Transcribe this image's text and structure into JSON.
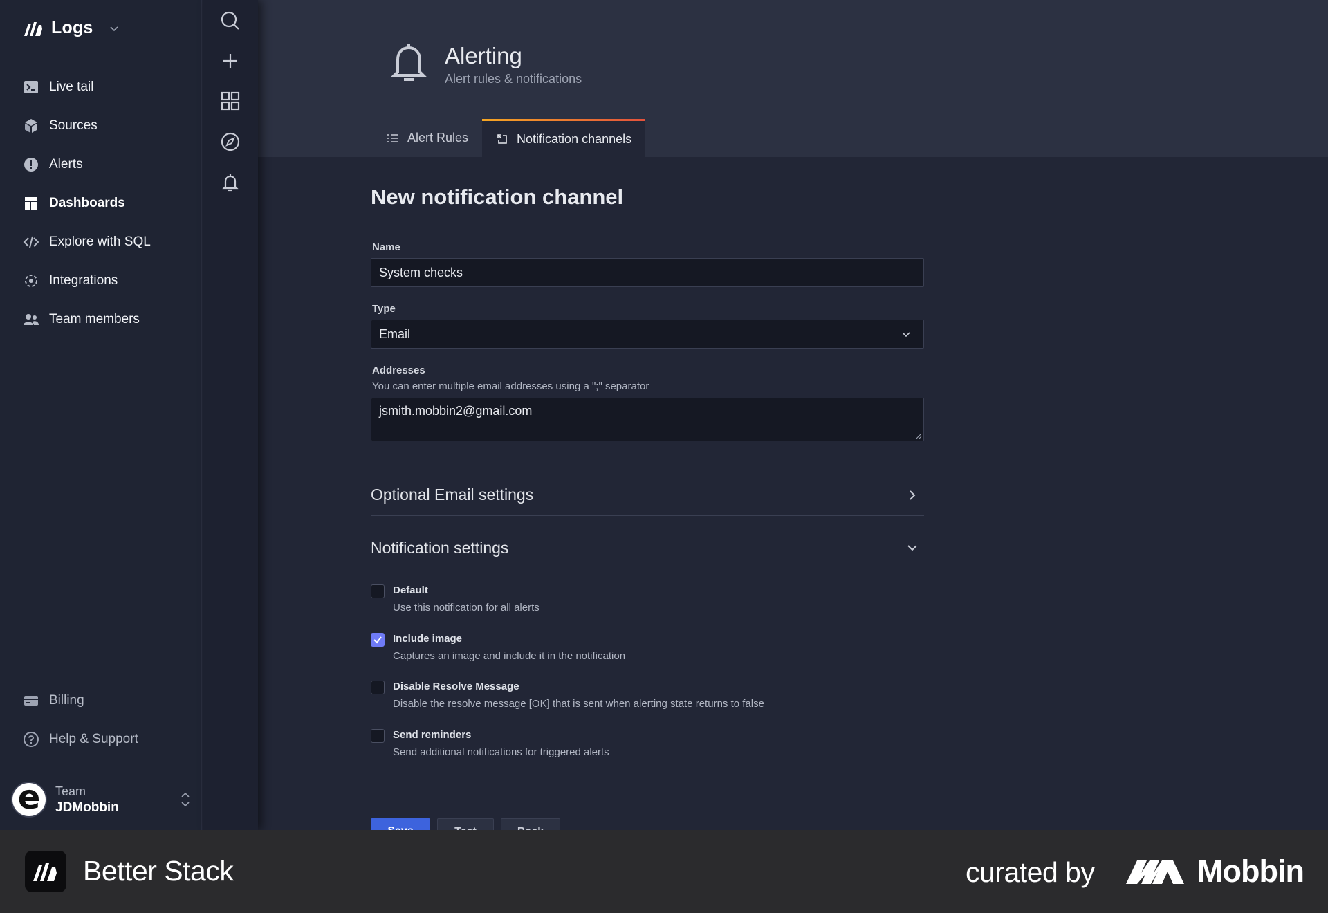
{
  "app": {
    "name": "Logs"
  },
  "sidebar": {
    "items": [
      {
        "label": "Live tail",
        "icon": "terminal-icon"
      },
      {
        "label": "Sources",
        "icon": "cube-icon"
      },
      {
        "label": "Alerts",
        "icon": "alert-circle-icon"
      },
      {
        "label": "Dashboards",
        "icon": "dashboard-icon"
      },
      {
        "label": "Explore with SQL",
        "icon": "code-icon"
      },
      {
        "label": "Integrations",
        "icon": "integrations-icon"
      },
      {
        "label": "Team members",
        "icon": "team-icon"
      }
    ],
    "bottom_items": [
      {
        "label": "Billing",
        "icon": "credit-card-icon"
      },
      {
        "label": "Help & Support",
        "icon": "help-circle-icon"
      }
    ],
    "team": {
      "label": "Team",
      "name": "JDMobbin",
      "avatar_letter": "e"
    }
  },
  "rail": {
    "icons": [
      "search-icon",
      "plus-icon",
      "grid-icon",
      "compass-icon",
      "bell-icon"
    ]
  },
  "header": {
    "title": "Alerting",
    "subtitle": "Alert rules & notifications",
    "tabs": [
      {
        "label": "Alert Rules",
        "active": false
      },
      {
        "label": "Notification channels",
        "active": true
      }
    ]
  },
  "form": {
    "title": "New notification channel",
    "name_label": "Name",
    "name_value": "System checks",
    "type_label": "Type",
    "type_value": "Email",
    "addresses_label": "Addresses",
    "addresses_hint": "You can enter multiple email addresses using a \";\" separator",
    "addresses_value": "jsmith.mobbin2@gmail.com",
    "optional_section": "Optional Email settings",
    "notification_section": "Notification settings",
    "options": [
      {
        "title": "Default",
        "description": "Use this notification for all alerts",
        "checked": false
      },
      {
        "title": "Include image",
        "description": "Captures an image and include it in the notification",
        "checked": true
      },
      {
        "title": "Disable Resolve Message",
        "description": "Disable the resolve message [OK] that is sent when alerting state returns to false",
        "checked": false
      },
      {
        "title": "Send reminders",
        "description": "Send additional notifications for triggered alerts",
        "checked": false
      }
    ],
    "buttons": {
      "save": "Save",
      "test": "Test",
      "back": "Back"
    }
  },
  "footer": {
    "app_name": "Better Stack",
    "curated_by": "curated by",
    "brand": "Mobbin"
  },
  "colors": {
    "accent": "#3d63dd",
    "checkbox": "#6f7bf7",
    "tab_gradient_start": "#f5a623",
    "tab_gradient_end": "#e3513c"
  }
}
